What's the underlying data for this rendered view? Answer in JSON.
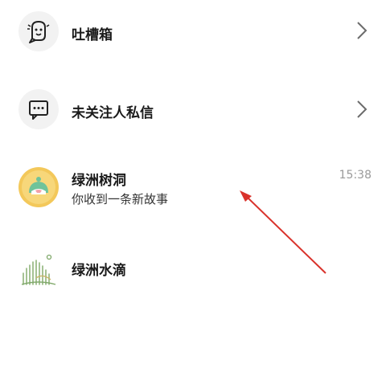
{
  "list": {
    "items": [
      {
        "title": "吐槽箱",
        "icon": "speech-bubble-ghost-icon"
      },
      {
        "title": "未关注人私信",
        "icon": "message-dots-icon"
      },
      {
        "title": "绿洲树洞",
        "subtitle": "你收到一条新故事",
        "time": "15:38",
        "icon": "tree-hole-avatar"
      },
      {
        "title": "绿洲水滴",
        "icon": "oasis-drop-logo"
      }
    ]
  },
  "colors": {
    "annotation_arrow": "#d9322b",
    "icon_bg": "#f2f2f2",
    "tree_hole_avatar": "#f3c85a",
    "oasis_green": "#7fa86a"
  }
}
